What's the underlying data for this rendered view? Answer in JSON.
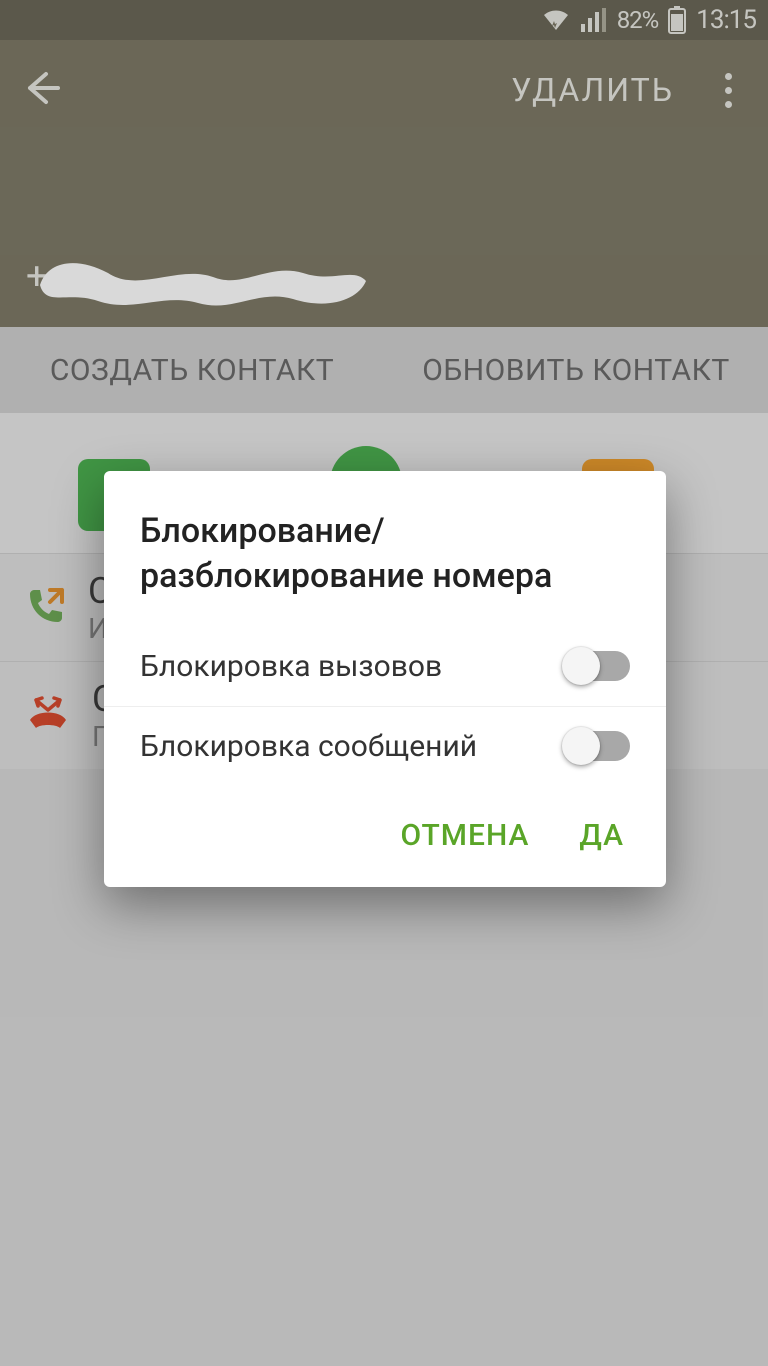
{
  "status": {
    "battery_pct": "82%",
    "time": "13:15"
  },
  "header": {
    "delete_label": "УДАЛИТЬ",
    "phone_prefix": "+"
  },
  "actions": {
    "create_contact": "СОЗДАТЬ КОНТАКТ",
    "update_contact": "ОБНОВИТЬ КОНТАКТ"
  },
  "rows": {
    "row1_t1": "С",
    "row1_t2": "И",
    "row2_t1": "С",
    "row2_t2": "П"
  },
  "dialog": {
    "title": "Блокирование/ разблокирование номера",
    "block_calls": "Блокировка вызовов",
    "block_messages": "Блокировка сообщений",
    "cancel": "ОТМЕНА",
    "ok": "ДА"
  }
}
